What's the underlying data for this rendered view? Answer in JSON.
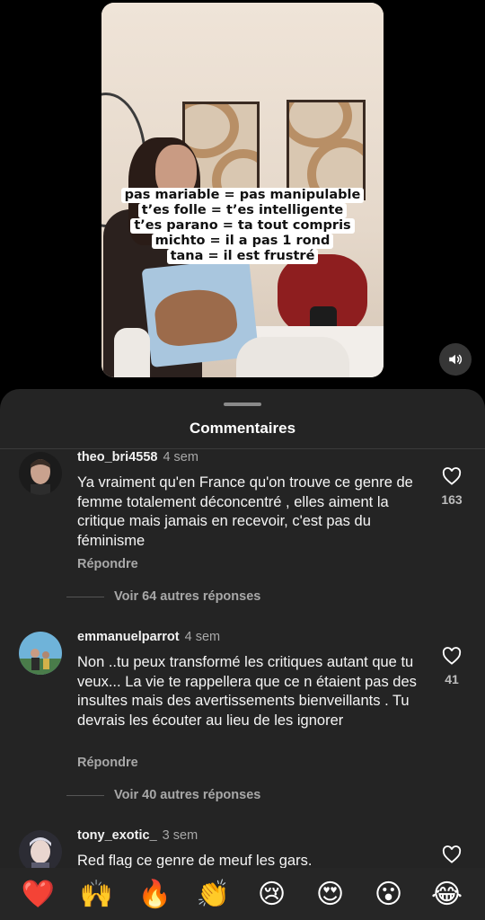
{
  "video": {
    "caption_lines": [
      "pas mariable = pas manipulable",
      "t’es folle = t’es intelligente",
      "t’es parano = ta tout compris",
      "michto = il a pas 1 rond",
      "tana = il est frustré"
    ],
    "sound_icon": "speaker-volume-icon"
  },
  "sheet": {
    "title": "Commentaires"
  },
  "comments": [
    {
      "username": "theo_bri4558",
      "time": "4 sem",
      "text": "Ya vraiment qu'en France qu'on trouve ce genre de femme totalement déconcentré , elles aiment la critique mais jamais en recevoir, c'est pas du féminisme",
      "reply_label": "Répondre",
      "likes": "163",
      "more_replies": "Voir 64 autres réponses"
    },
    {
      "username": "emmanuelparrot",
      "time": "4 sem",
      "text": "Non ..tu peux transformé les critiques autant que tu veux... La vie te rappellera que ce n étaient pas des insultes mais des avertissements bienveillants . Tu devrais les écouter au lieu de les ignorer",
      "reply_label": "Répondre",
      "likes": "41",
      "more_replies": "Voir 40 autres réponses"
    },
    {
      "username": "tony_exotic_",
      "time": "3 sem",
      "text": "Red flag ce genre de meuf les gars."
    }
  ],
  "emoji_bar": [
    "❤️",
    "🙌",
    "🔥",
    "👏",
    "😢",
    "😍",
    "😮",
    "😂"
  ],
  "colors": {
    "sheet_bg": "#242424",
    "text_muted": "#a8a8a8",
    "background": "#000000"
  }
}
